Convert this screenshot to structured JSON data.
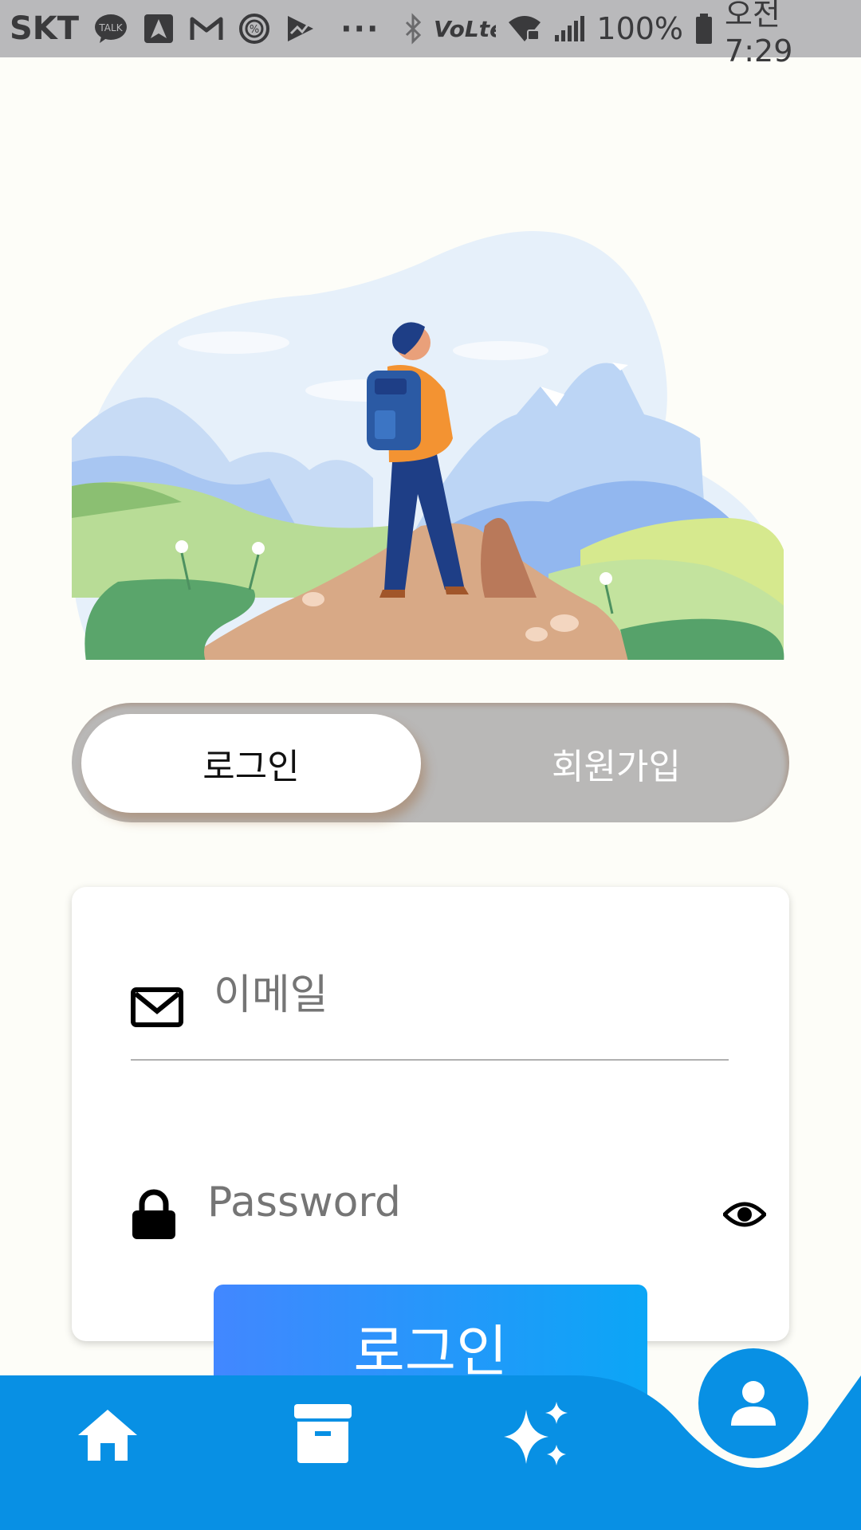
{
  "status_bar": {
    "carrier": "SKT",
    "more": "···",
    "battery": "100%",
    "time": "오전 7:29",
    "icons": [
      "kakaotalk-icon",
      "navigation-icon",
      "gmail-icon",
      "percent-icon",
      "trend-icon",
      "bluetooth-icon",
      "volte-icon",
      "wifi-icon",
      "signal-icon",
      "battery-icon"
    ]
  },
  "auth_toggle": {
    "login_label": "로그인",
    "signup_label": "회원가입",
    "selected": "login"
  },
  "form": {
    "email_placeholder": "이메일",
    "password_placeholder": "Password"
  },
  "login_button": "로그인",
  "bottom_nav": {
    "items": [
      "home-icon",
      "archive-icon",
      "sparkles-icon",
      "profile-icon"
    ],
    "active": "profile",
    "color": "#0890e4"
  },
  "colors": {
    "primary": "#0890e4",
    "button_gradient_start": "#4287ff",
    "button_gradient_end": "#0ba6f6",
    "toggle_bg": "#b9b8b7"
  }
}
